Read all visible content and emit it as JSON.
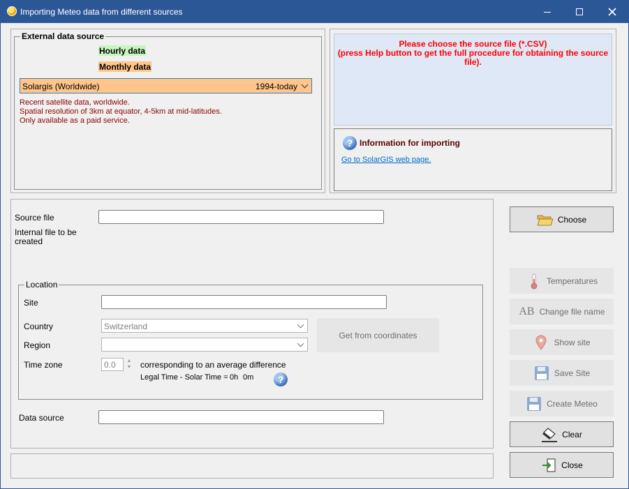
{
  "window": {
    "title": "Importing Meteo data from different sources"
  },
  "external_source": {
    "legend": "External data source",
    "hourly_label": "Hourly data",
    "monthly_label": "Monthly data",
    "selected_source": "Solargis (Worldwide)",
    "selected_period": "1994-today",
    "description": [
      "Recent satellite data, worldwide.",
      "Spatial resolution of 3km at equator, 4-5km at mid-latitudes.",
      "Only available as a paid service."
    ]
  },
  "info": {
    "message": [
      "Please choose the source file (*.CSV)",
      "(press Help button to get the full procedure for obtaining the source",
      "file)."
    ],
    "title": "Information for importing",
    "link": "Go to SolarGIS web page."
  },
  "main": {
    "source_file_label": "Source file",
    "source_file_value": "",
    "internal_file_label_1": "Internal file to be",
    "internal_file_label_2": "created",
    "location": {
      "legend": "Location",
      "site_label": "Site",
      "site_value": "",
      "country_label": "Country",
      "country_value": "Switzerland",
      "region_label": "Region",
      "region_value": "",
      "get_coords_label": "Get from coordinates",
      "timezone_label": "Time zone",
      "timezone_value": "0.0",
      "avg_diff_text": "corresponding to an average difference",
      "legal_time_label": "Legal Time - Solar Time =",
      "legal_time_h": "0h",
      "legal_time_m": "0m"
    },
    "data_source_label": "Data source",
    "data_source_value": ""
  },
  "buttons": {
    "choose": "Choose",
    "temperatures": "Temperatures",
    "change_file_name": "Change file name",
    "show_site": "Show site",
    "save_site": "Save Site",
    "create_meteo": "Create Meteo",
    "clear": "Clear",
    "close": "Close"
  },
  "icons": {
    "ab_text": "AB",
    "help_glyph": "?"
  }
}
